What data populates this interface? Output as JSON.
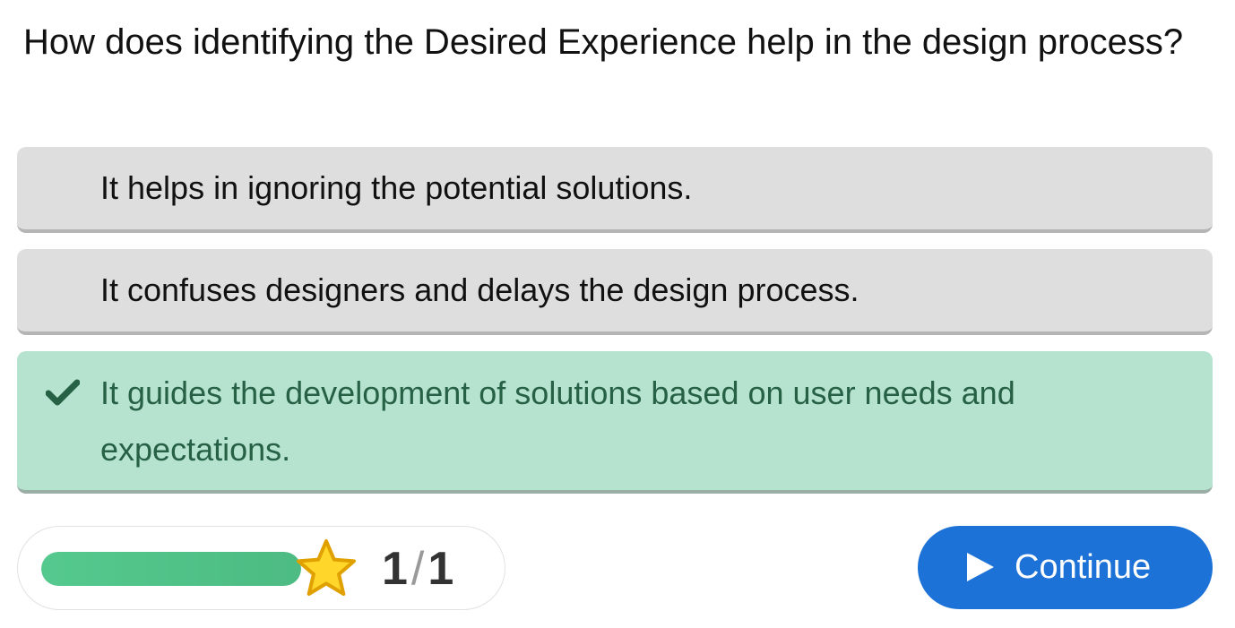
{
  "question": {
    "text": "How does identifying the Desired Experience help in the design process?"
  },
  "options": [
    {
      "text": "It helps in ignoring the potential solutions.",
      "state": "neutral"
    },
    {
      "text": "It confuses designers and delays the design process.",
      "state": "neutral"
    },
    {
      "text": "It guides the development of solutions based on user needs and expectations.",
      "state": "correct"
    }
  ],
  "progress": {
    "fraction_complete": 1.0,
    "current": "1",
    "separator": "/",
    "total": "1",
    "icon": "star-icon"
  },
  "continue_button": {
    "label": "Continue",
    "icon": "play-icon"
  },
  "colors": {
    "neutral_option_bg": "#dedede",
    "correct_option_bg": "#b6e3cf",
    "correct_text": "#276145",
    "progress_fill": "#54c98e",
    "button_bg": "#1d72d8",
    "star_fill": "#ffd629",
    "star_outline": "#e0a000"
  }
}
